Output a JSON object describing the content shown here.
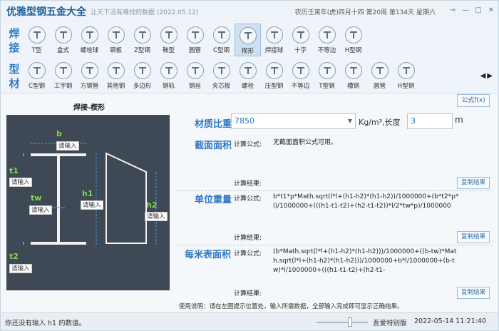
{
  "app": {
    "title": "优雅型钢五金大全",
    "subtitle": "让天下没有难找的数据 (2022.05.12)",
    "lunar_date": "农历壬寅年(虎)四月十四 第20周 第134天 星期六",
    "win_controls": [
      "⊸",
      "—",
      "□",
      "✕"
    ]
  },
  "ribbon": {
    "row1_category": [
      "焊",
      "接"
    ],
    "row2_category": [
      "型",
      "材"
    ],
    "row1_items": [
      {
        "label": "T型",
        "icon": "t-section-icon"
      },
      {
        "label": "盒式",
        "icon": "box-section-icon"
      },
      {
        "label": "螺栓球",
        "icon": "bolt-ball-icon"
      },
      {
        "label": "钢板",
        "icon": "steel-plate-icon"
      },
      {
        "label": "Z型钢",
        "icon": "z-section-icon"
      },
      {
        "label": "鞍型",
        "icon": "saddle-icon"
      },
      {
        "label": "圆管",
        "icon": "round-pipe-icon"
      },
      {
        "label": "C型钢",
        "icon": "c-section-icon"
      },
      {
        "label": "楔形",
        "icon": "wedge-icon",
        "active": true
      },
      {
        "label": "焊接球",
        "icon": "welded-ball-icon"
      },
      {
        "label": "十字",
        "icon": "cross-icon"
      },
      {
        "label": "不等边",
        "icon": "unequal-icon"
      },
      {
        "label": "H型钢",
        "icon": "h-section-icon"
      }
    ],
    "row2_items": [
      {
        "label": "C型钢",
        "icon": "c-section-icon"
      },
      {
        "label": "工字钢",
        "icon": "i-beam-icon"
      },
      {
        "label": "方钢管",
        "icon": "square-tube-icon"
      },
      {
        "label": "其他钢",
        "icon": "other-steel-icon"
      },
      {
        "label": "多边形",
        "icon": "polygon-icon"
      },
      {
        "label": "钢轨",
        "icon": "rail-icon"
      },
      {
        "label": "钢丝",
        "icon": "wire-icon"
      },
      {
        "label": "夹芯板",
        "icon": "sandwich-panel-icon"
      },
      {
        "label": "螺栓",
        "icon": "bolt-icon"
      },
      {
        "label": "压型钢",
        "icon": "profiled-steel-icon"
      },
      {
        "label": "不等边",
        "icon": "unequal-angle-icon"
      },
      {
        "label": "T型钢",
        "icon": "t-steel-icon"
      },
      {
        "label": "槽钢",
        "icon": "channel-icon"
      },
      {
        "label": "圆管",
        "icon": "round-pipe-icon"
      },
      {
        "label": "H型钢",
        "icon": "h-beam-icon"
      }
    ],
    "nav_prev": "◀",
    "nav_next": "▶"
  },
  "diagram": {
    "title": "焊接-楔形",
    "labels": {
      "b": "b",
      "t1": "t1",
      "tw": "tw",
      "h1": "h1",
      "h2": "h2",
      "t2": "t2"
    },
    "placeholder": "请输入"
  },
  "form": {
    "formula_button": "公式f(x)",
    "density_label": "材质比重",
    "density_value": "7850",
    "density_unit": "Kg/m³,长度",
    "length_value": "3",
    "length_unit": "m",
    "formula_label": "计算公式:",
    "result_label": "计算结果:",
    "copy_button": "复制结果",
    "sections": [
      {
        "title": "截面面积",
        "formula": "无截面面积公式可用。"
      },
      {
        "title": "单位重量",
        "formula": "b*t1*p*Math.sqrt(l*l+(h1-h2)*(h1-h2))/1000000+(b*t2*p*l)/1000000+(((h1-t1-t2)+(h2-t1-t2))*l/2*tw*p)/1000000"
      },
      {
        "title": "每米表面积",
        "formula": "(b*Math.sqrt(l*l+(h1-h2)*(h1-h2)))/1000000+((b-tw)*Math.sqrt(l*l+(h1-h2)*(h1-h2)))/1000000+b*l/1000000+(b-tw)*l/1000000+(((h1-t1-t2)+(h2-t1-"
      }
    ],
    "usage": "使用说明：请在左图提示位置处，输入所需数据，全部输入完成即可显示正确结果。"
  },
  "status": {
    "message": "你还没有输入 h1 的数值。",
    "edition": "吾爱特别版",
    "datetime": "2022-05-14 11:21:40"
  }
}
